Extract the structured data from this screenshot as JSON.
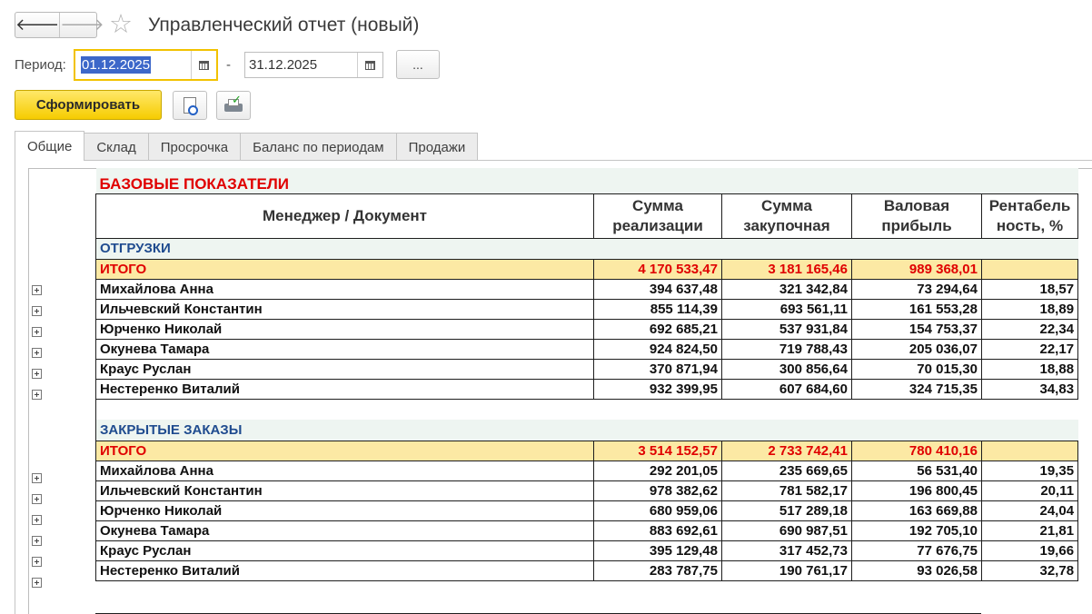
{
  "window": {
    "title": "Управленческий отчет (новый)"
  },
  "nav": {
    "back": "🡐",
    "forward": "🡒",
    "favorite": "☆"
  },
  "period": {
    "label": "Период:",
    "from": "01.12.2025",
    "separator": "-",
    "to": "31.12.2025",
    "more": "..."
  },
  "toolbar": {
    "generate": "Сформировать"
  },
  "tabs": [
    "Общие",
    "Склад",
    "Просрочка",
    "Баланс по периодам",
    "Продажи"
  ],
  "report": {
    "title": "БАЗОВЫЕ ПОКАЗАТЕЛИ",
    "columns": {
      "manager": "Менеджер / Документ",
      "sales": "Сумма реализации",
      "purchase": "Сумма закупочная",
      "profit": "Валовая прибыль",
      "margin": "Рентабельность, %"
    },
    "sections": [
      {
        "name": "ОТГРУЗКИ",
        "total": {
          "label": "ИТОГО",
          "sales": "4 170 533,47",
          "purchase": "3 181 165,46",
          "profit": "989 368,01",
          "margin": ""
        },
        "rows": [
          {
            "name": "Михайлова Анна",
            "sales": "394 637,48",
            "purchase": "321 342,84",
            "profit": "73 294,64",
            "margin": "18,57"
          },
          {
            "name": "Ильчевский Константин",
            "sales": "855 114,39",
            "purchase": "693 561,11",
            "profit": "161 553,28",
            "margin": "18,89"
          },
          {
            "name": "Юрченко Николай",
            "sales": "692 685,21",
            "purchase": "537 931,84",
            "profit": "154 753,37",
            "margin": "22,34"
          },
          {
            "name": "Окунева Тамара",
            "sales": "924 824,50",
            "purchase": "719 788,43",
            "profit": "205 036,07",
            "margin": "22,17"
          },
          {
            "name": "Краус Руслан",
            "sales": "370 871,94",
            "purchase": "300 856,64",
            "profit": "70 015,30",
            "margin": "18,88"
          },
          {
            "name": "Нестеренко Виталий",
            "sales": "932 399,95",
            "purchase": "607 684,60",
            "profit": "324 715,35",
            "margin": "34,83"
          }
        ]
      },
      {
        "name": "ЗАКРЫТЫЕ ЗАКАЗЫ",
        "total": {
          "label": "ИТОГО",
          "sales": "3 514 152,57",
          "purchase": "2 733 742,41",
          "profit": "780 410,16",
          "margin": ""
        },
        "rows": [
          {
            "name": "Михайлова Анна",
            "sales": "292 201,05",
            "purchase": "235 669,65",
            "profit": "56 531,40",
            "margin": "19,35"
          },
          {
            "name": "Ильчевский Константин",
            "sales": "978 382,62",
            "purchase": "781 582,17",
            "profit": "196 800,45",
            "margin": "20,11"
          },
          {
            "name": "Юрченко Николай",
            "sales": "680 959,06",
            "purchase": "517 289,18",
            "profit": "163 669,88",
            "margin": "24,04"
          },
          {
            "name": "Окунева Тамара",
            "sales": "883 692,61",
            "purchase": "690 987,51",
            "profit": "192 705,10",
            "margin": "21,81"
          },
          {
            "name": "Краус Руслан",
            "sales": "395 129,48",
            "purchase": "317 452,73",
            "profit": "77 676,75",
            "margin": "19,66"
          },
          {
            "name": "Нестеренко Виталий",
            "sales": "283 787,75",
            "purchase": "190 761,17",
            "profit": "93 026,58",
            "margin": "32,78"
          }
        ]
      }
    ]
  }
}
